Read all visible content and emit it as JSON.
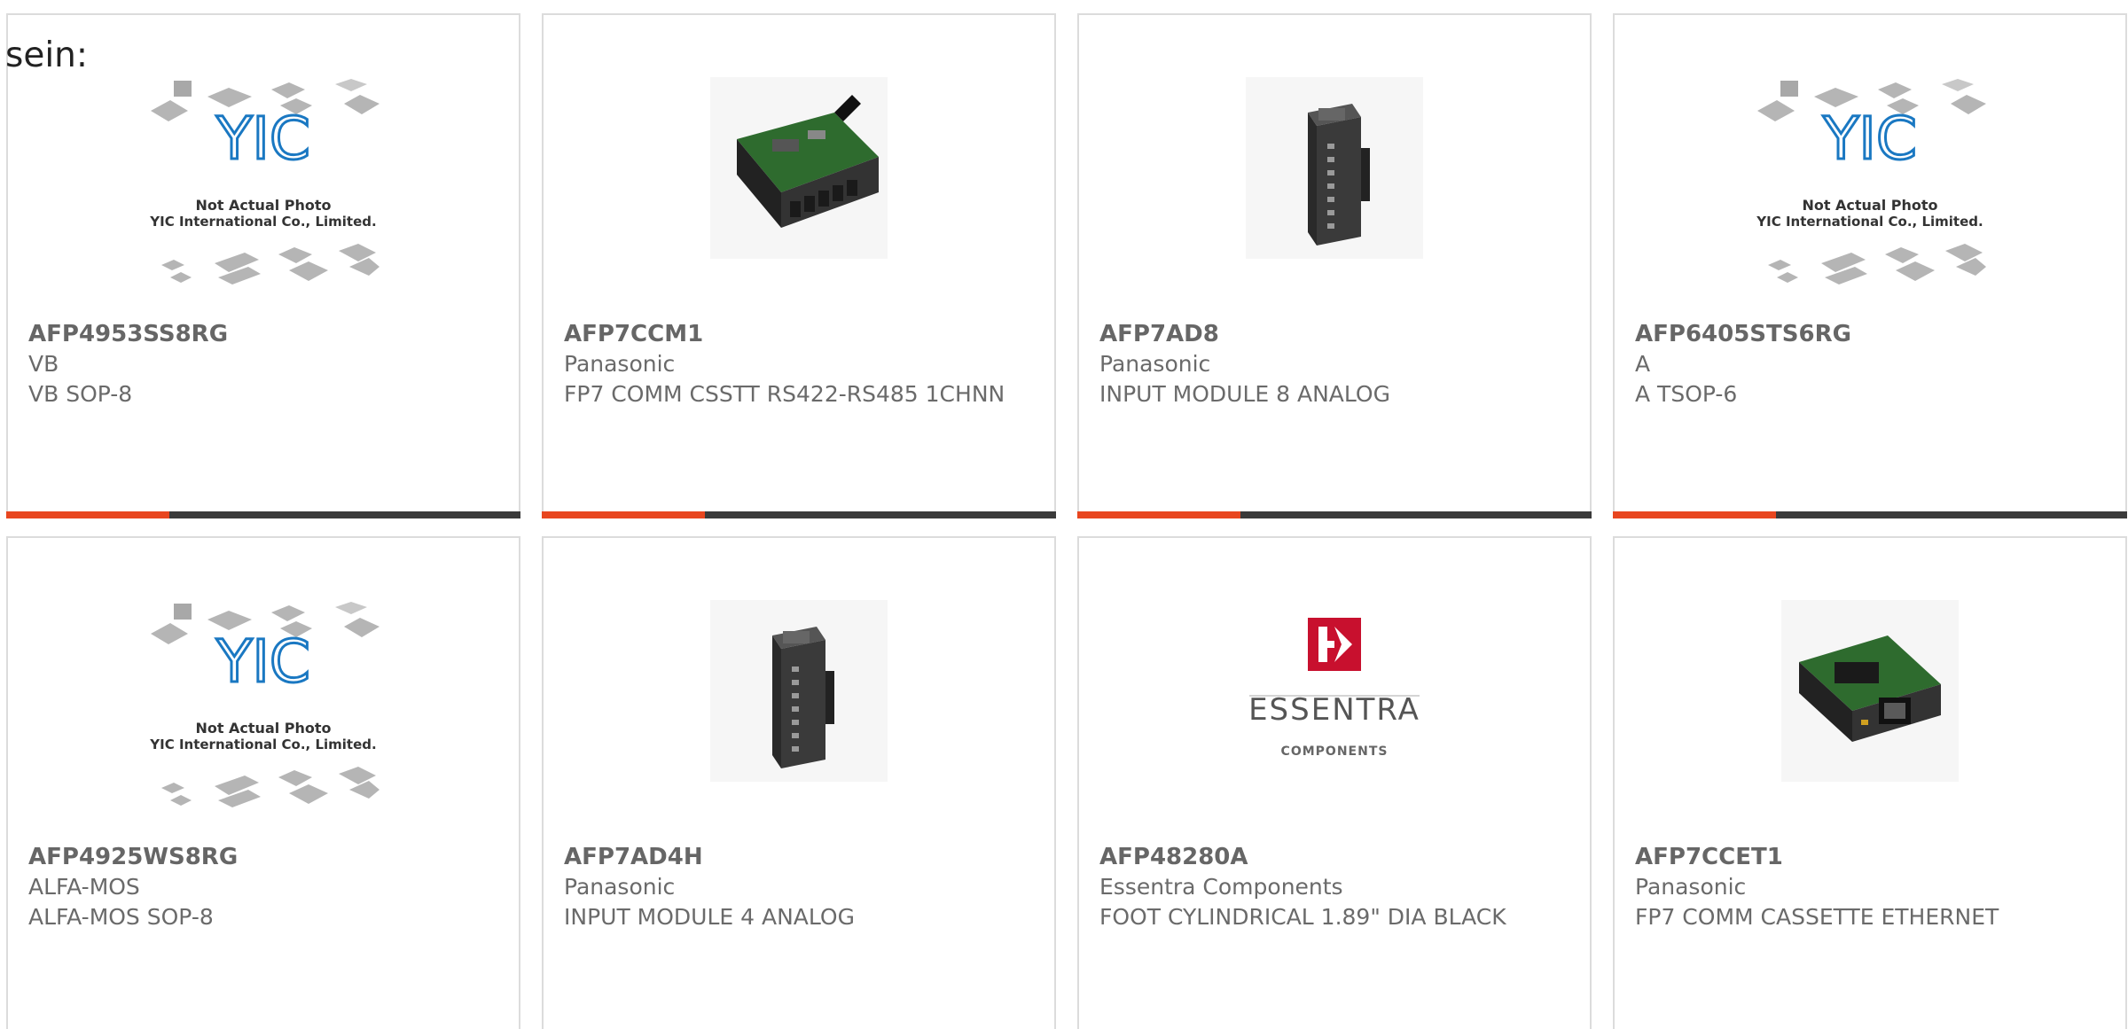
{
  "intro_text": "sein:",
  "placeholder_caption": {
    "line1": "Not Actual Photo",
    "line2": "YIC International Co., Limited.",
    "logo_text": "YIC"
  },
  "essentra_logo": {
    "name": "ESSENTRA",
    "tagline": "COMPONENTS"
  },
  "colors": {
    "accent": "#e8461f",
    "bar": "#3a3a3a",
    "border": "#dcdcdc",
    "text": "#6a6a6a",
    "yic_blue": "#1a78c2"
  },
  "products": [
    {
      "part_number": "AFP4953SS8RG",
      "manufacturer": "VB",
      "description": "VB SOP-8",
      "image": "yic-placeholder"
    },
    {
      "part_number": "AFP7CCM1",
      "manufacturer": "Panasonic",
      "description": "FP7 COMM CSSTT RS422-RS485 1CHNN",
      "image": "comm-cassette-board"
    },
    {
      "part_number": "AFP7AD8",
      "manufacturer": "Panasonic",
      "description": "INPUT MODULE 8 ANALOG",
      "image": "input-module"
    },
    {
      "part_number": "AFP6405STS6RG",
      "manufacturer": "A",
      "description": "A TSOP-6",
      "image": "yic-placeholder"
    },
    {
      "part_number": "AFP4925WS8RG",
      "manufacturer": "ALFA-MOS",
      "description": "ALFA-MOS SOP-8",
      "image": "yic-placeholder"
    },
    {
      "part_number": "AFP7AD4H",
      "manufacturer": "Panasonic",
      "description": "INPUT MODULE 4 ANALOG",
      "image": "input-module"
    },
    {
      "part_number": "AFP48280A",
      "manufacturer": "Essentra Components",
      "description": "FOOT CYLINDRICAL 1.89\" DIA BLACK",
      "image": "essentra-logo"
    },
    {
      "part_number": "AFP7CCET1",
      "manufacturer": "Panasonic",
      "description": "FP7 COMM CASSETTE ETHERNET",
      "image": "ethernet-cassette"
    }
  ]
}
